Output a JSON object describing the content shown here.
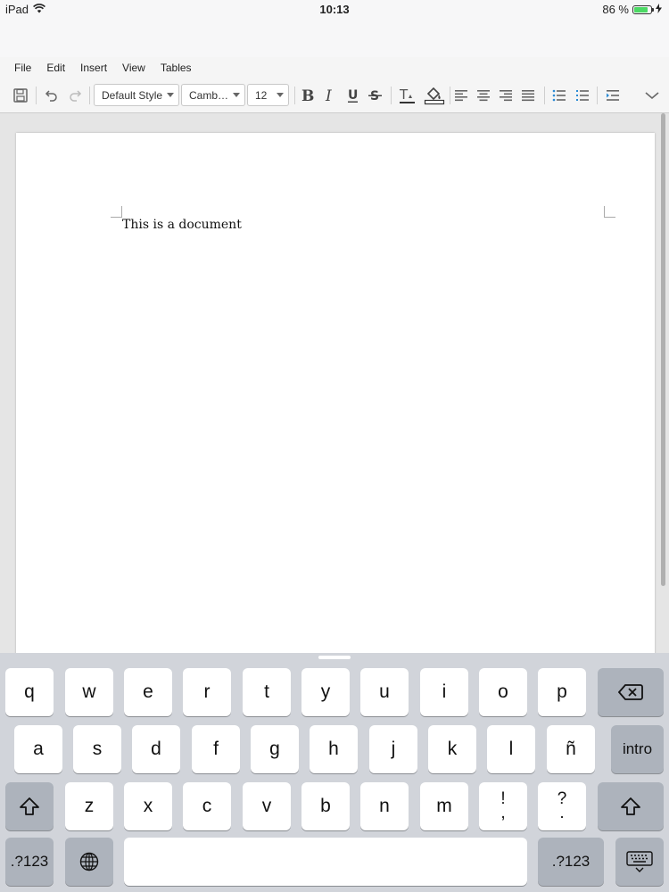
{
  "status": {
    "device": "iPad",
    "time": "10:13",
    "battery": "86 %",
    "battery_level": 0.86
  },
  "menu": [
    "File",
    "Edit",
    "Insert",
    "View",
    "Tables"
  ],
  "toolbar": {
    "style": "Default Style",
    "font": "Camb…",
    "size": "12"
  },
  "document": {
    "text": "This is a document"
  },
  "keyboard": {
    "row1": [
      "q",
      "w",
      "e",
      "r",
      "t",
      "y",
      "u",
      "i",
      "o",
      "p"
    ],
    "row2": [
      "a",
      "s",
      "d",
      "f",
      "g",
      "h",
      "j",
      "k",
      "l",
      "ñ"
    ],
    "row3": [
      "z",
      "x",
      "c",
      "v",
      "b",
      "n",
      "m"
    ],
    "punct1": {
      "top": "!",
      "bottom": ","
    },
    "punct2": {
      "top": "?",
      "bottom": "."
    },
    "return_label": "intro",
    "numbers_label": ".?123"
  }
}
